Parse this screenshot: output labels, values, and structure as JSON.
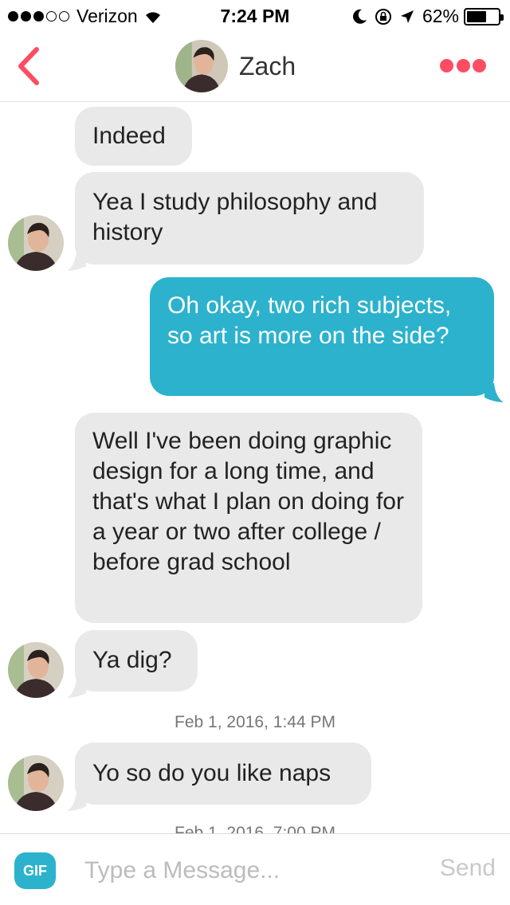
{
  "status_bar": {
    "carrier": "Verizon",
    "signal": "●●●○○",
    "time": "7:24 PM",
    "battery_percent": "62%",
    "battery_level": 0.62,
    "icons": [
      "wifi-icon",
      "moon-icon",
      "rotation-lock-icon",
      "location-icon",
      "battery-icon"
    ]
  },
  "header": {
    "back_icon": "chevron-left-icon",
    "name": "Zach",
    "more_icon": "more-dots-icon",
    "accent_color": "#fd4d63"
  },
  "messages": [
    {
      "from": "them",
      "text": "Indeed"
    },
    {
      "from": "them",
      "text": "Yea I study philosophy and history"
    },
    {
      "from": "me",
      "text": "Oh okay, two rich subjects, so art is more on the side?"
    },
    {
      "from": "them",
      "text": "Well I've been doing graphic design for a long time, and that's what I plan on doing for a year or two after college / before grad school"
    },
    {
      "from": "them",
      "text": "Ya dig?"
    },
    {
      "from": "timestamp",
      "text": "Feb 1, 2016, 1:44 PM"
    },
    {
      "from": "them",
      "text": "Yo so do you like naps"
    },
    {
      "from": "timestamp",
      "text": "Feb 1, 2016, 7:00 PM"
    }
  ],
  "colors": {
    "incoming_bubble": "#e9e9e9",
    "outgoing_bubble": "#2cb2cc"
  },
  "composer": {
    "gif_label": "GIF",
    "placeholder": "Type a Message...",
    "send_label": "Send"
  }
}
